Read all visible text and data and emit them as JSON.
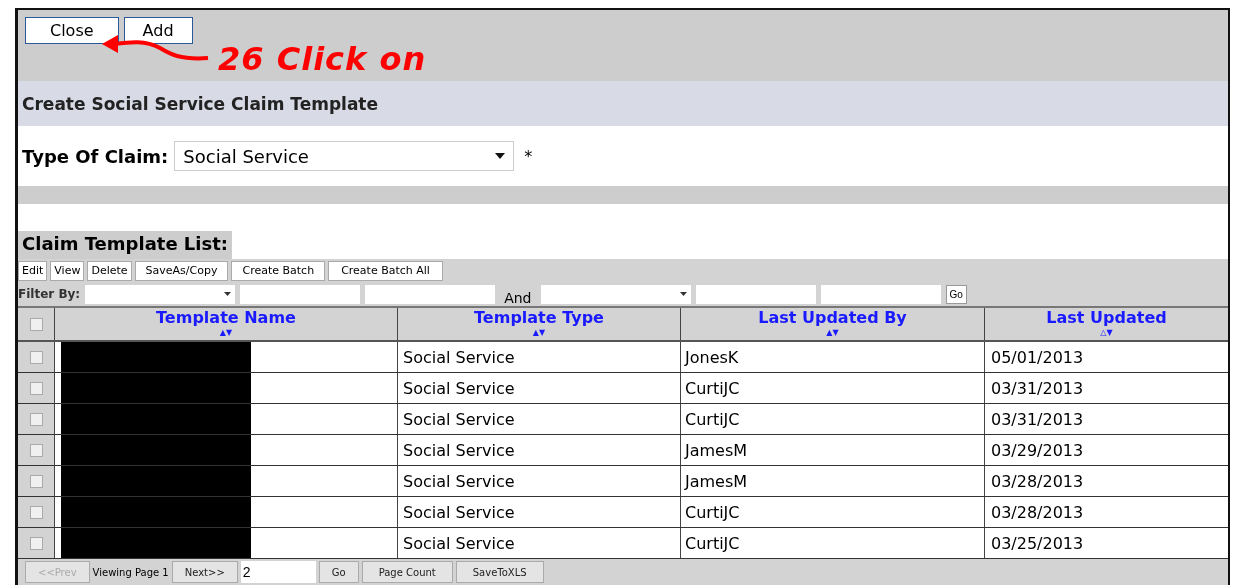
{
  "top_buttons": [
    "Close",
    "Add"
  ],
  "annotation": {
    "text": "26 Click on"
  },
  "page_title": "Create Social Service Claim Template",
  "claim_type": {
    "label": "Type Of Claim:",
    "value": "Social Service",
    "required_mark": "*"
  },
  "list_title": "Claim Template List:",
  "toolbar_buttons": [
    "Edit",
    "View",
    "Delete",
    "SaveAs/Copy",
    "Create Batch",
    "Create Batch All"
  ],
  "filter": {
    "label": "Filter By:",
    "conjunction": "And",
    "go": "Go"
  },
  "table": {
    "select_all_checked": false,
    "columns": [
      {
        "label": "Template Name",
        "sort": "▲▼"
      },
      {
        "label": "Template Type",
        "sort": "▲▼"
      },
      {
        "label": "Last Updated By",
        "sort": "▲▼"
      },
      {
        "label": "Last Updated",
        "sort": "△▼"
      }
    ],
    "rows": [
      {
        "checked": false,
        "type": "Social Service",
        "by": "JonesK",
        "date": "05/01/2013"
      },
      {
        "checked": false,
        "type": "Social Service",
        "by": "CurtiJC",
        "date": "03/31/2013"
      },
      {
        "checked": false,
        "type": "Social Service",
        "by": "CurtiJC",
        "date": "03/31/2013"
      },
      {
        "checked": false,
        "type": "Social Service",
        "by": "JamesM",
        "date": "03/29/2013"
      },
      {
        "checked": false,
        "type": "Social Service",
        "by": "JamesM",
        "date": "03/28/2013"
      },
      {
        "checked": false,
        "type": "Social Service",
        "by": "CurtiJC",
        "date": "03/28/2013"
      },
      {
        "checked": false,
        "type": "Social Service",
        "by": "CurtiJC",
        "date": "03/25/2013"
      }
    ]
  },
  "pager": {
    "prev": {
      "label": "<<Prev",
      "disabled": true
    },
    "status": "Viewing Page 1",
    "next": {
      "label": "Next>>",
      "disabled": false
    },
    "page_input": "2",
    "go": "Go",
    "buttons": [
      "Page Count",
      "SaveToXLS"
    ]
  }
}
